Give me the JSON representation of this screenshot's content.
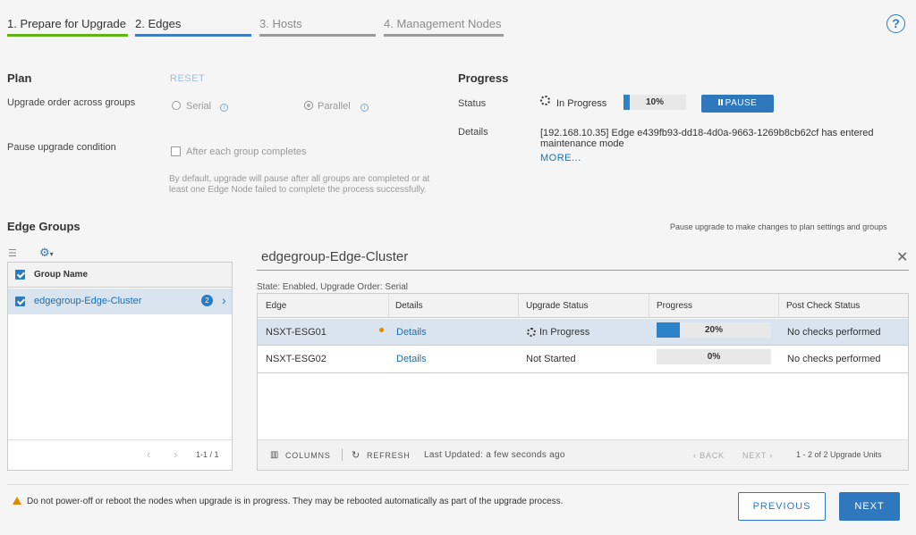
{
  "steps": [
    {
      "label": "1. Prepare for Upgrade"
    },
    {
      "label": "2. Edges"
    },
    {
      "label": "3. Hosts"
    },
    {
      "label": "4. Management Nodes"
    }
  ],
  "help_icon": "?",
  "plan": {
    "title": "Plan",
    "reset": "RESET",
    "order_label": "Upgrade order across groups",
    "serial": "Serial",
    "parallel": "Parallel",
    "pause_label": "Pause upgrade condition",
    "pause_option": "After each group completes",
    "pause_note": "By default, upgrade will pause after all groups are completed or at least one Edge Node failed to complete the process successfully."
  },
  "progress": {
    "title": "Progress",
    "status_label": "Status",
    "status_value": "In Progress",
    "percent_text": "10%",
    "percent": 10,
    "pause_button": "PAUSE",
    "details_label": "Details",
    "details_text": "[192.168.10.35] Edge e439fb93-dd18-4d0a-9663-1269b8cb62cf has entered maintenance mode",
    "more": "MORE..."
  },
  "edge_groups": {
    "title": "Edge Groups",
    "pause_hint": "Pause upgrade to make changes to plan settings and groups",
    "column": "Group Name",
    "group_name": "edgegroup-Edge-Cluster",
    "group_count": "2",
    "pager": "1-1 / 1"
  },
  "detail": {
    "title": "edgegroup-Edge-Cluster",
    "state": "State: Enabled, Upgrade Order: Serial",
    "columns": [
      "Edge",
      "Details",
      "Upgrade Status",
      "Progress",
      "Post Check Status"
    ],
    "rows": [
      {
        "edge": "NSXT-ESG01",
        "details": "Details",
        "status": "In Progress",
        "progress_text": "20%",
        "progress": 20,
        "post": "No checks performed"
      },
      {
        "edge": "NSXT-ESG02",
        "details": "Details",
        "status": "Not Started",
        "progress_text": "0%",
        "progress": 0,
        "post": "No checks performed"
      }
    ],
    "columns_btn": "COLUMNS",
    "refresh_btn": "REFRESH",
    "last_updated": "Last Updated: a few seconds ago",
    "back": "BACK",
    "next": "NEXT",
    "count": "1 - 2 of 2 Upgrade Units"
  },
  "footer": {
    "warning": "Do not power-off or reboot the nodes when upgrade is in progress. They may be rebooted automatically as part of the upgrade process.",
    "previous": "PREVIOUS",
    "next": "NEXT"
  },
  "colors": {
    "accent": "#2f78bd",
    "done": "#60b515",
    "warning": "#e08a00"
  }
}
